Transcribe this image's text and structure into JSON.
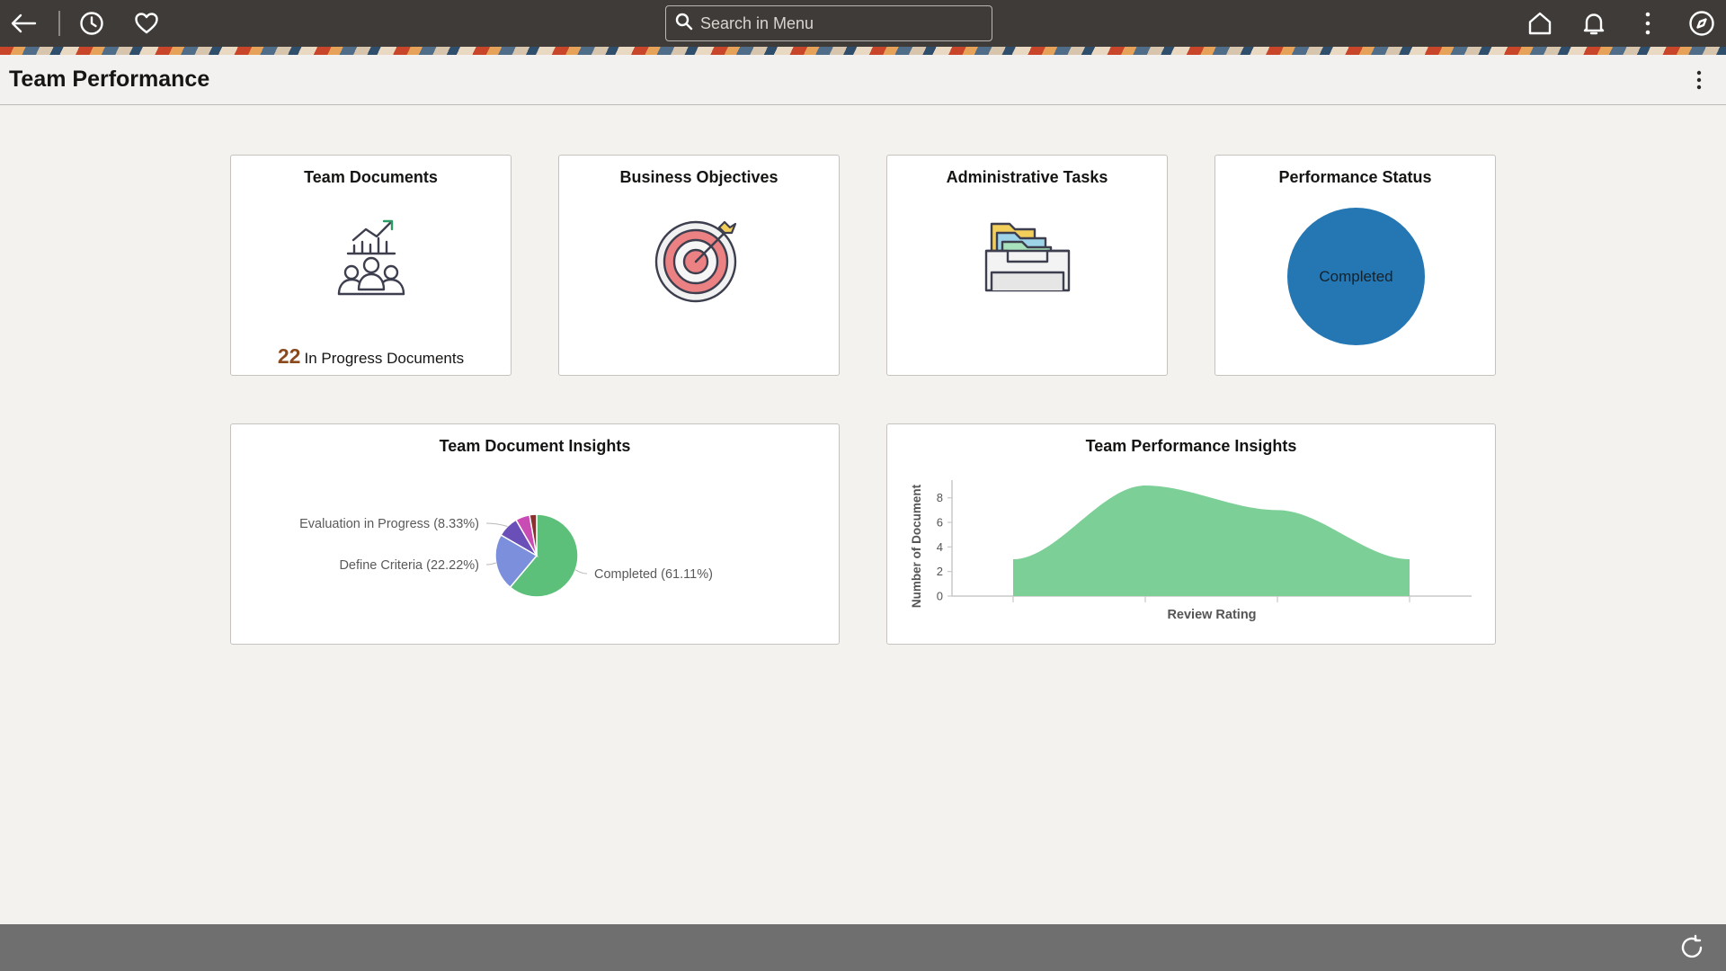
{
  "search": {
    "placeholder": "Search in Menu"
  },
  "page": {
    "title": "Team Performance"
  },
  "tiles": {
    "team_documents": {
      "title": "Team Documents",
      "count": "22",
      "count_label": "In Progress Documents"
    },
    "business_objectives": {
      "title": "Business Objectives"
    },
    "administrative_tasks": {
      "title": "Administrative Tasks"
    },
    "performance_status": {
      "title": "Performance Status",
      "status": "Completed",
      "color": "#2477b3"
    },
    "team_document_insights": {
      "title": "Team Document Insights"
    },
    "team_performance_insights": {
      "title": "Team Performance Insights"
    }
  },
  "icons": {
    "back": "back-arrow-icon",
    "recent": "clock-icon",
    "favorites": "heart-icon",
    "search": "search-icon",
    "home": "home-icon",
    "notifications": "bell-icon",
    "actions": "kebab-icon",
    "navigator": "compass-icon",
    "refresh": "refresh-icon"
  },
  "chart_data": [
    {
      "type": "pie",
      "title": "Team Document Insights",
      "slices": [
        {
          "label": "Completed (61.11%)",
          "value": 61.11,
          "color": "#5cc07a"
        },
        {
          "label": "Define Criteria (22.22%)",
          "value": 22.22,
          "color": "#7b8fdc"
        },
        {
          "label": "Evaluation in Progress (8.33%)",
          "value": 8.33,
          "color": "#6a4fb8"
        },
        {
          "label": "",
          "value": 5.56,
          "color": "#c94bb4"
        },
        {
          "label": "",
          "value": 2.78,
          "color": "#8e2f2f"
        }
      ]
    },
    {
      "type": "area",
      "title": "Team Performance Insights",
      "xlabel": "Review Rating",
      "ylabel": "Number of Document",
      "ylim": [
        0,
        9
      ],
      "yticks": [
        0,
        2,
        4,
        6,
        8
      ],
      "x": [
        1,
        2,
        3,
        4
      ],
      "values": [
        3,
        9,
        7,
        3
      ],
      "color": "#7ccf97"
    }
  ]
}
